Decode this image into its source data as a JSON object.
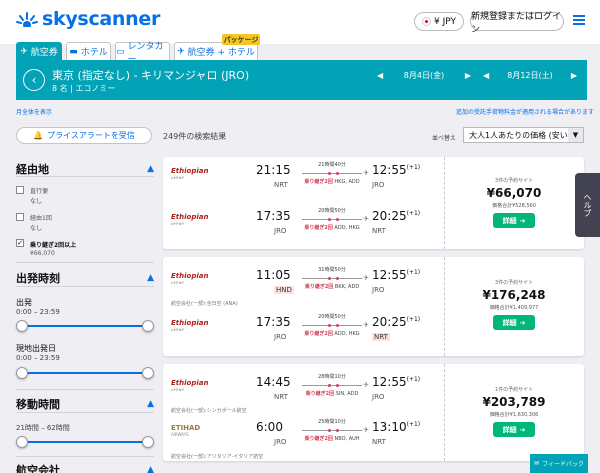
{
  "header": {
    "logo_text": "skyscanner",
    "currency_label": "¥ JPY",
    "login_label": "新規登録またはログイン",
    "menu_icon": "hamburger-icon",
    "flag_color": "#d90029"
  },
  "tabs": [
    {
      "label": "航空券",
      "icon": "plane-icon",
      "active": true
    },
    {
      "label": "ホテル",
      "icon": "bed-icon",
      "active": false
    },
    {
      "label": "レンタカー",
      "icon": "car-icon",
      "active": false
    },
    {
      "label": "航空券 + ホテル",
      "icon": "plane-hotel-icon",
      "active": false
    }
  ],
  "package_badge": "パッケージ",
  "search": {
    "route": "東京 (指定なし) - キリマンジャロ (JRO)",
    "passengers": "8 名 | エコノミー",
    "depart_date": "8月4日(金)",
    "return_date": "8月12日(土)"
  },
  "links": {
    "show_full_month": "月全体を表示",
    "baggage_notice": "追加の受託手荷物料金が適用される場合があります"
  },
  "alert_button": "プライスアラートを受信",
  "result_count": "249件の検索結果",
  "sort": {
    "label": "並べ替え",
    "value": "大人1人あたりの価格 (安い順)"
  },
  "filters": {
    "stops": {
      "title": "経由地",
      "options": [
        {
          "label": "直行便",
          "sub": "なし",
          "checked": false
        },
        {
          "label": "経由1回",
          "sub": "なし",
          "checked": false
        },
        {
          "label": "乗り継ぎ2回以上",
          "sub": "¥66,070",
          "checked": true
        }
      ]
    },
    "departure_time": {
      "title": "出発時刻",
      "outbound_label": "出発",
      "outbound_range": "0:00 – 23:59",
      "return_label": "現地出発日",
      "return_range": "0:00 – 23:59"
    },
    "duration": {
      "title": "移動時間",
      "range": "21時間 – 62時間"
    },
    "airlines": {
      "title": "航空会社"
    }
  },
  "results": [
    {
      "legs": [
        {
          "airline": "Ethiopian",
          "dep_time": "21:15",
          "dep_code": "NRT",
          "dep_hl": false,
          "duration": "21時間40分",
          "stops": "乗り継ぎ2回",
          "via": "HKG, ADD",
          "arr_time": "12:55",
          "arr_plus": "(+1)",
          "arr_code": "JRO",
          "arr_hl": false
        },
        {
          "airline": "Ethiopian",
          "dep_time": "17:35",
          "dep_code": "JRO",
          "dep_hl": false,
          "duration": "20時間50分",
          "stops": "乗り継ぎ2回",
          "via": "ADD, HKG",
          "arr_time": "20:25",
          "arr_plus": "(+1)",
          "arr_code": "NRT",
          "arr_hl": false
        }
      ],
      "operated_note": "",
      "price_source": "3件の予約サイト",
      "price": "¥66,070",
      "total": "価格合計¥528,560",
      "button": "詳細"
    },
    {
      "legs": [
        {
          "airline": "Ethiopian",
          "dep_time": "11:05",
          "dep_code": "HND",
          "dep_hl": true,
          "duration": "31時間50分",
          "stops": "乗り継ぎ2回",
          "via": "BKK, ADD",
          "arr_time": "12:55",
          "arr_plus": "(+1)",
          "arr_code": "JRO",
          "arr_hl": false
        },
        {
          "airline": "Ethiopian",
          "dep_time": "17:35",
          "dep_code": "JRO",
          "dep_hl": false,
          "duration": "20時間50分",
          "stops": "乗り継ぎ2回",
          "via": "ADD, HKG",
          "arr_time": "20:25",
          "arr_plus": "(+1)",
          "arr_code": "NRT",
          "arr_hl": true
        }
      ],
      "operated_note": "航空会社(一部):全日空 (ANA)",
      "price_source": "3件の予約サイト",
      "price": "¥176,248",
      "total": "価格合計¥1,409,977",
      "button": "詳細"
    },
    {
      "legs": [
        {
          "airline": "Ethiopian",
          "dep_time": "14:45",
          "dep_code": "NRT",
          "dep_hl": false,
          "duration": "28時間10分",
          "stops": "乗り継ぎ2回",
          "via": "SIN, ADD",
          "arr_time": "12:55",
          "arr_plus": "(+1)",
          "arr_code": "JRO",
          "arr_hl": false
        },
        {
          "airline": "ETIHAD",
          "dep_time": "6:00",
          "dep_code": "JRO",
          "dep_hl": false,
          "duration": "25時間10分",
          "stops": "乗り継ぎ2回",
          "via": "NBO, AUH",
          "arr_time": "13:10",
          "arr_plus": "(+1)",
          "arr_code": "NRT",
          "arr_hl": false
        }
      ],
      "operated_note": "航空会社(一部):シンガポール航空",
      "operated_note_2": "航空会社(一部):アリタリア-イタリア航空",
      "price_source": "1件の予約サイト",
      "price": "¥203,789",
      "total": "価格合計¥1,630,306",
      "button": "詳細"
    }
  ],
  "help_tab": "ヘルプ",
  "feedback": "フィードバック",
  "colors": {
    "brand_blue": "#0770e3",
    "search_bar": "#02a3b6",
    "select_button": "#00b67a",
    "stops_red": "#d1435b",
    "ethiopian_red": "#b0221b",
    "etihad_gold": "#9c7a3c"
  }
}
